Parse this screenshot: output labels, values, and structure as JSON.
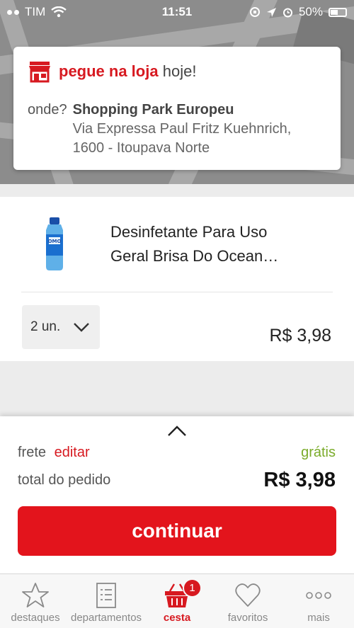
{
  "status_bar": {
    "carrier": "TIM",
    "time": "11:51",
    "battery": "50%"
  },
  "store": {
    "title_highlight": "pegue na loja",
    "title_rest": "hoje!",
    "where_label": "onde?",
    "name": "Shopping Park Europeu",
    "address": "Via Expressa Paul Fritz Kuehnrich, 1600 - Itoupava Norte"
  },
  "product": {
    "name": "Desinfetante Para Uso Geral Brisa Do Ocean…",
    "quantity": "2 un.",
    "price": "R$ 3,98"
  },
  "summary": {
    "shipping_label": "frete",
    "edit_label": "editar",
    "shipping_value": "grátis",
    "total_label": "total do pedido",
    "total_value": "R$ 3,98",
    "continue_label": "continuar"
  },
  "tabs": [
    {
      "label": "destaques",
      "icon": "star-icon"
    },
    {
      "label": "departamentos",
      "icon": "list-icon"
    },
    {
      "label": "cesta",
      "icon": "basket-icon",
      "badge": "1",
      "active": true
    },
    {
      "label": "favoritos",
      "icon": "heart-icon"
    },
    {
      "label": "mais",
      "icon": "more-icon"
    }
  ],
  "colors": {
    "brand_red": "#d71920",
    "free_green": "#7aab2a"
  }
}
